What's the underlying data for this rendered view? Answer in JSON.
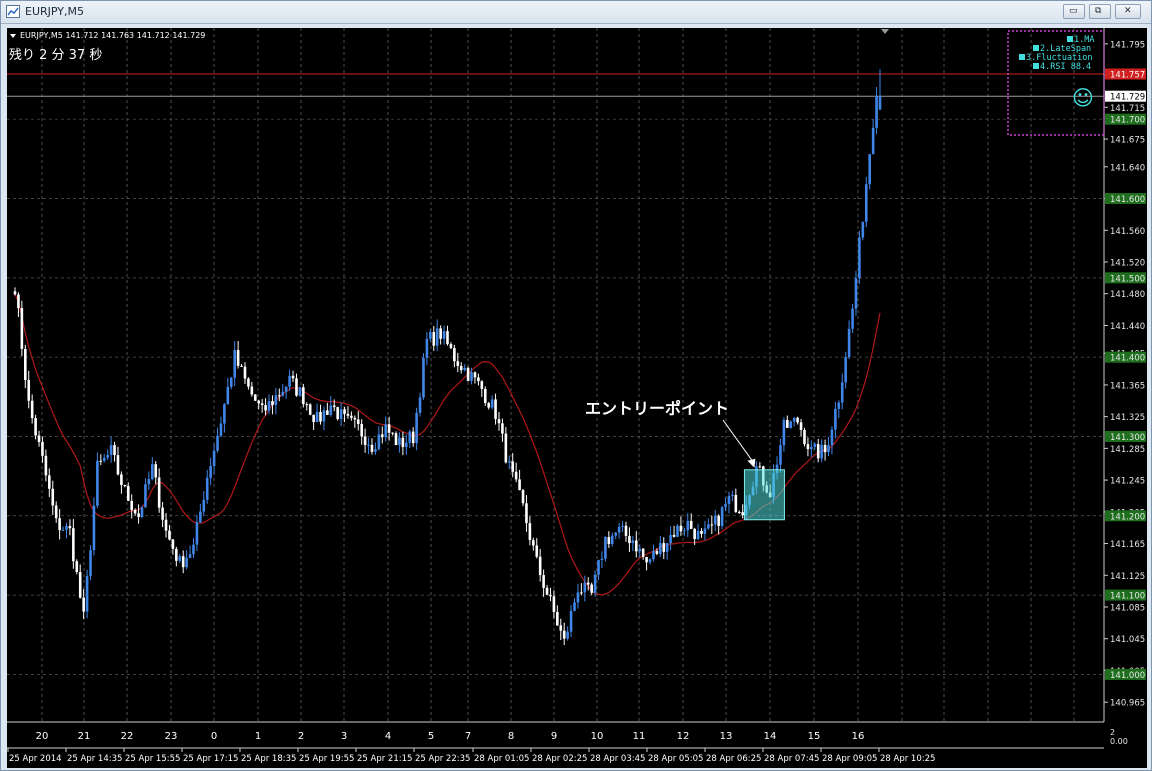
{
  "window": {
    "title": "EURJPY,M5",
    "buttons": {
      "minimize": "▭",
      "restore": "⧉",
      "close": "✕"
    }
  },
  "chart_header": {
    "symbol_line": "EURJPY,M5  141.712 141.763 141.712 141.729",
    "countdown": "残り 2 分 37 秒"
  },
  "annotation": {
    "text": "エントリーポイント"
  },
  "indicator_panel": {
    "items": [
      "1.MA",
      "2.LateSpan",
      "3.Fluctuation",
      "4.RSI 88.4"
    ],
    "smiley": "☺"
  },
  "price_labels": {
    "red_line": "141.757",
    "white_line": "141.729",
    "green_levels": [
      "141.700",
      "141.600",
      "141.500",
      "141.400",
      "141.300",
      "141.200",
      "141.100",
      "141.000"
    ]
  },
  "chart_data": {
    "type": "candlestick",
    "symbol": "EURJPY",
    "timeframe": "M5",
    "ohlc_last": {
      "open": 141.712,
      "high": 141.763,
      "low": 141.712,
      "close": 141.729
    },
    "ylim": [
      140.94,
      141.815
    ],
    "y_ticks": [
      "141.795",
      "141.755",
      "141.715",
      "141.675",
      "141.640",
      "141.600",
      "141.560",
      "141.520",
      "141.480",
      "141.440",
      "141.405",
      "141.365",
      "141.325",
      "141.285",
      "141.245",
      "141.205",
      "141.165",
      "141.125",
      "141.085",
      "141.045",
      "141.005",
      "140.965"
    ],
    "hour_labels": [
      "20",
      "21",
      "22",
      "23",
      "0",
      "1",
      "2",
      "3",
      "4",
      "5",
      "7",
      "8",
      "9",
      "10",
      "11",
      "12",
      "13",
      "14",
      "15",
      "16"
    ],
    "x_tick_labels": [
      "25 Apr 2014",
      "25 Apr 14:35",
      "25 Apr 15:55",
      "25 Apr 17:15",
      "25 Apr 18:35",
      "25 Apr 19:55",
      "25 Apr 21:15",
      "25 Apr 22:35",
      "28 Apr 01:05",
      "28 Apr 02:25",
      "28 Apr 03:45",
      "28 Apr 05:05",
      "28 Apr 06:25",
      "28 Apr 07:45",
      "28 Apr 09:05",
      "28 Apr 10:25"
    ],
    "lower_axis_labels": [
      "2",
      "0.00"
    ],
    "close_anchors": [
      [
        0,
        141.49
      ],
      [
        4,
        141.34
      ],
      [
        8,
        141.27
      ],
      [
        12,
        141.19
      ],
      [
        16,
        141.18
      ],
      [
        20,
        141.07
      ],
      [
        24,
        141.26
      ],
      [
        28,
        141.28
      ],
      [
        32,
        141.23
      ],
      [
        36,
        141.2
      ],
      [
        40,
        141.26
      ],
      [
        44,
        141.18
      ],
      [
        48,
        141.14
      ],
      [
        52,
        141.16
      ],
      [
        56,
        141.25
      ],
      [
        60,
        141.32
      ],
      [
        64,
        141.4
      ],
      [
        68,
        141.36
      ],
      [
        72,
        141.33
      ],
      [
        76,
        141.35
      ],
      [
        80,
        141.37
      ],
      [
        84,
        141.35
      ],
      [
        88,
        141.32
      ],
      [
        92,
        141.34
      ],
      [
        96,
        141.32
      ],
      [
        100,
        141.31
      ],
      [
        104,
        141.29
      ],
      [
        108,
        141.31
      ],
      [
        112,
        141.29
      ],
      [
        116,
        141.3
      ],
      [
        120,
        141.42
      ],
      [
        124,
        141.43
      ],
      [
        128,
        141.4
      ],
      [
        132,
        141.38
      ],
      [
        136,
        141.36
      ],
      [
        140,
        141.33
      ],
      [
        144,
        141.26
      ],
      [
        148,
        141.21
      ],
      [
        152,
        141.14
      ],
      [
        156,
        141.09
      ],
      [
        160,
        141.04
      ],
      [
        164,
        141.11
      ],
      [
        168,
        141.1
      ],
      [
        172,
        141.17
      ],
      [
        176,
        141.18
      ],
      [
        180,
        141.17
      ],
      [
        184,
        141.14
      ],
      [
        188,
        141.16
      ],
      [
        192,
        141.18
      ],
      [
        196,
        141.19
      ],
      [
        200,
        141.17
      ],
      [
        204,
        141.19
      ],
      [
        208,
        141.22
      ],
      [
        212,
        141.21
      ],
      [
        216,
        141.26
      ],
      [
        220,
        141.23
      ],
      [
        224,
        141.31
      ],
      [
        228,
        141.32
      ],
      [
        232,
        141.28
      ],
      [
        236,
        141.28
      ],
      [
        240,
        141.35
      ],
      [
        244,
        141.46
      ],
      [
        248,
        141.62
      ],
      [
        251,
        141.74
      ],
      [
        252,
        141.729
      ]
    ],
    "candle_count": 253
  }
}
